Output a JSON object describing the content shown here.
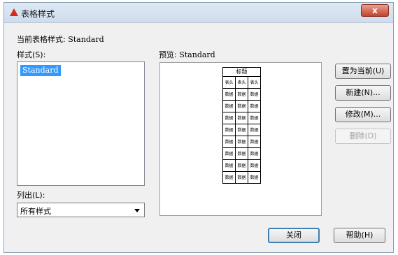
{
  "window": {
    "title": "表格样式",
    "close_glyph": "x"
  },
  "current_style": {
    "label": "当前表格样式:",
    "value": "Standard"
  },
  "styles": {
    "label": "样式(S):",
    "items": [
      "Standard"
    ]
  },
  "list_filter": {
    "label": "列出(L):",
    "selected": "所有样式"
  },
  "preview": {
    "label": "预览:",
    "style_name": "Standard",
    "table_title": "标题",
    "header_row": [
      "表头",
      "表头",
      "表头"
    ],
    "data_row": [
      "数据",
      "数据",
      "数据"
    ]
  },
  "buttons": {
    "set_current": "置为当前(U)",
    "new": "新建(N)...",
    "modify": "修改(M)...",
    "delete": "删除(D)",
    "close": "关闭",
    "help": "帮助(H)"
  }
}
